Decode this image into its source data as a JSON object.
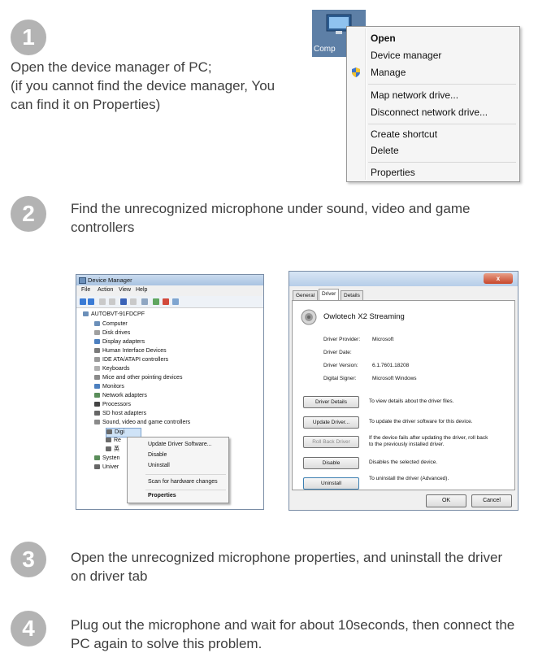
{
  "steps": [
    {
      "number": "1",
      "text_line1": "Open the device manager of PC;",
      "text_line2": "(if you cannot find the device manager, You",
      "text_line3": "can find it on Properties)"
    },
    {
      "number": "2",
      "text_line1": "Find the unrecognized microphone under sound, video and game",
      "text_line2": "controllers"
    },
    {
      "number": "3",
      "text_line1": "Open the unrecognized microphone properties, and uninstall the driver",
      "text_line2": "on driver tab"
    },
    {
      "number": "4",
      "text_line1": "Plug out the microphone and wait for about 10seconds, then connect the",
      "text_line2": "PC again to solve this problem."
    }
  ],
  "desktop_icon": {
    "label": "Comp"
  },
  "context_menu": {
    "open": "Open",
    "device_manager": "Device manager",
    "manage": "Manage",
    "map_network_drive": "Map network drive...",
    "disconnect_network_drive": "Disconnect network drive...",
    "create_shortcut": "Create shortcut",
    "delete": "Delete",
    "properties": "Properties"
  },
  "device_manager": {
    "title": "Device Manager",
    "menu": [
      "File",
      "Action",
      "View",
      "Help"
    ],
    "tree": [
      "AUTOBVT-91FDCPF",
      "Computer",
      "Disk drives",
      "Display adapters",
      "Human Interface Devices",
      "IDE ATA/ATAPI controllers",
      "Keyboards",
      "Mice and other pointing devices",
      "Monitors",
      "Network adapters",
      "Processors",
      "SD host adapters",
      "Sound, video and game controllers",
      "Digi",
      "Re",
      "英",
      "Systen",
      "Univer"
    ],
    "context_menu": {
      "update": "Update Driver Software...",
      "disable": "Disable",
      "uninstall": "Uninstall",
      "scan": "Scan for hardware changes",
      "properties": "Properties"
    }
  },
  "properties_dialog": {
    "close": "x",
    "tabs": [
      "General",
      "Driver",
      "Details"
    ],
    "device_name": "Owlotech X2 Streaming",
    "fields": [
      {
        "label": "Driver Provider:",
        "value": "Microsoft"
      },
      {
        "label": "Driver Date:",
        "value": ""
      },
      {
        "label": "Driver Version:",
        "value": "6.1.7601.18208"
      },
      {
        "label": "Digital Signer:",
        "value": "Microsoft Windows"
      }
    ],
    "buttons": [
      {
        "label": "Driver Details",
        "desc": "To view details about the driver files."
      },
      {
        "label": "Update Driver...",
        "desc": "To update the driver software for this device."
      },
      {
        "label": "Roll Back Driver",
        "desc": "If the device fails after updating the driver, roll back to the previously installed driver."
      },
      {
        "label": "Disable",
        "desc": "Disables the selected device."
      },
      {
        "label": "Uninstall",
        "desc": "To uninstall the driver (Advanced)."
      }
    ],
    "ok": "OK",
    "cancel": "Cancel"
  },
  "colors": {
    "step_circle": "#b3b3b3",
    "text": "#3f3f3f"
  }
}
